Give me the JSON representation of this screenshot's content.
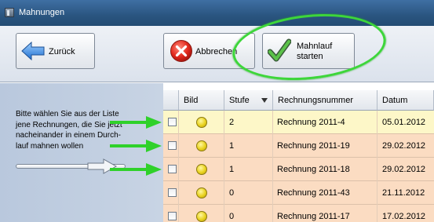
{
  "window": {
    "title": "Mahnungen"
  },
  "toolbar": {
    "back_label": "Zurück",
    "cancel_label": "Abbrechen",
    "start_label_line1": "Mahnlauf",
    "start_label_line2": "starten"
  },
  "hint": {
    "line1": "Bitte wählen Sie aus der Liste",
    "line2": "jene Rechnungen, die Sie jetzt",
    "line3": "nacheinander in einem Durch-",
    "line4": "lauf mahnen wollen"
  },
  "table": {
    "columns": [
      "Bild",
      "Stufe",
      "Rechnungsnummer",
      "Datum"
    ],
    "rows": [
      {
        "checked": false,
        "stufe": "2",
        "nummer": "Rechnung 2011-4",
        "datum": "05.01.2012",
        "bg": "#fdf7c8"
      },
      {
        "checked": false,
        "stufe": "1",
        "nummer": "Rechnung 2011-19",
        "datum": "29.02.2012",
        "bg": "#fbdcc2"
      },
      {
        "checked": false,
        "stufe": "1",
        "nummer": "Rechnung 2011-18",
        "datum": "29.02.2012",
        "bg": "#fbdcc2"
      },
      {
        "checked": false,
        "stufe": "0",
        "nummer": "Rechnung 2011-43",
        "datum": "21.11.2012",
        "bg": "#fbdcc2"
      },
      {
        "checked": false,
        "stufe": "0",
        "nummer": "Rechnung 2011-17",
        "datum": "17.02.2012",
        "bg": "#fbdcc2"
      }
    ]
  },
  "colors": {
    "annotation_green": "#2fd12a",
    "title_bar": "#2a5580",
    "panel_blue": "#c2cfe0"
  },
  "icons": {
    "back": "arrow-left-icon",
    "cancel": "red-x-icon",
    "start": "checkmark-icon",
    "status": "yellow-dot-icon",
    "sort": "sort-desc-icon"
  }
}
